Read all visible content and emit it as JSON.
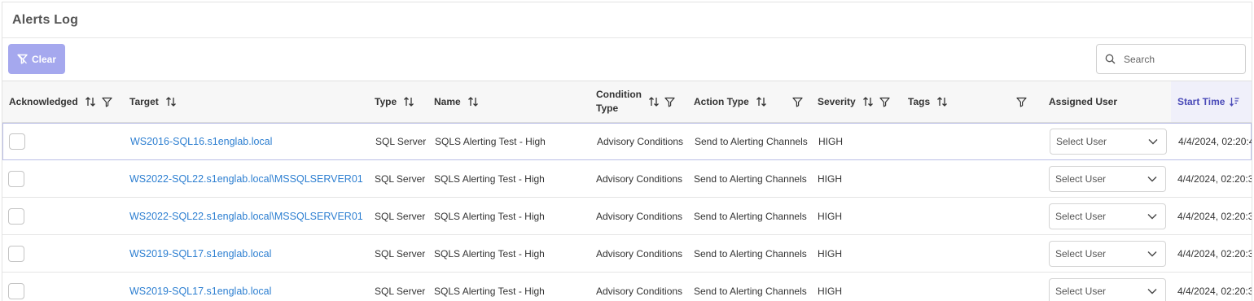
{
  "page": {
    "title": "Alerts Log"
  },
  "toolbar": {
    "clear_label": "Clear",
    "search_placeholder": "Search"
  },
  "columns": [
    {
      "label": "Acknowledged"
    },
    {
      "label": "Target"
    },
    {
      "label": "Type"
    },
    {
      "label": "Name"
    },
    {
      "label": "Condition Type"
    },
    {
      "label": "Action Type"
    },
    {
      "label": "Severity"
    },
    {
      "label": "Tags"
    },
    {
      "label": "Assigned User"
    },
    {
      "label": "Start Time"
    }
  ],
  "rows": [
    {
      "target": "WS2016-SQL16.s1englab.local",
      "type": "SQL Server",
      "name": "SQLS Alerting Test - High",
      "condition_type": "Advisory Conditions",
      "action_type": "Send to Alerting Channels",
      "severity": "HIGH",
      "tags": "",
      "assigned_user": "Select User",
      "start_time": "4/4/2024, 02:20:4"
    },
    {
      "target": "WS2022-SQL22.s1englab.local\\MSSQLSERVER01",
      "type": "SQL Server",
      "name": "SQLS Alerting Test - High",
      "condition_type": "Advisory Conditions",
      "action_type": "Send to Alerting Channels",
      "severity": "HIGH",
      "tags": "",
      "assigned_user": "Select User",
      "start_time": "4/4/2024, 02:20:3"
    },
    {
      "target": "WS2022-SQL22.s1englab.local\\MSSQLSERVER01",
      "type": "SQL Server",
      "name": "SQLS Alerting Test - High",
      "condition_type": "Advisory Conditions",
      "action_type": "Send to Alerting Channels",
      "severity": "HIGH",
      "tags": "",
      "assigned_user": "Select User",
      "start_time": "4/4/2024, 02:20:3"
    },
    {
      "target": "WS2019-SQL17.s1englab.local",
      "type": "SQL Server",
      "name": "SQLS Alerting Test - High",
      "condition_type": "Advisory Conditions",
      "action_type": "Send to Alerting Channels",
      "severity": "HIGH",
      "tags": "",
      "assigned_user": "Select User",
      "start_time": "4/4/2024, 02:20:3"
    },
    {
      "target": "WS2019-SQL17.s1englab.local",
      "type": "SQL Server",
      "name": "SQLS Alerting Test - High",
      "condition_type": "Advisory Conditions",
      "action_type": "Send to Alerting Channels",
      "severity": "HIGH",
      "tags": "",
      "assigned_user": "Select User",
      "start_time": "4/4/2024, 02:20:3"
    }
  ],
  "colors": {
    "accent": "#4a4ab8",
    "clear_button": "#a5a8ee",
    "link": "#2d7fd1"
  }
}
